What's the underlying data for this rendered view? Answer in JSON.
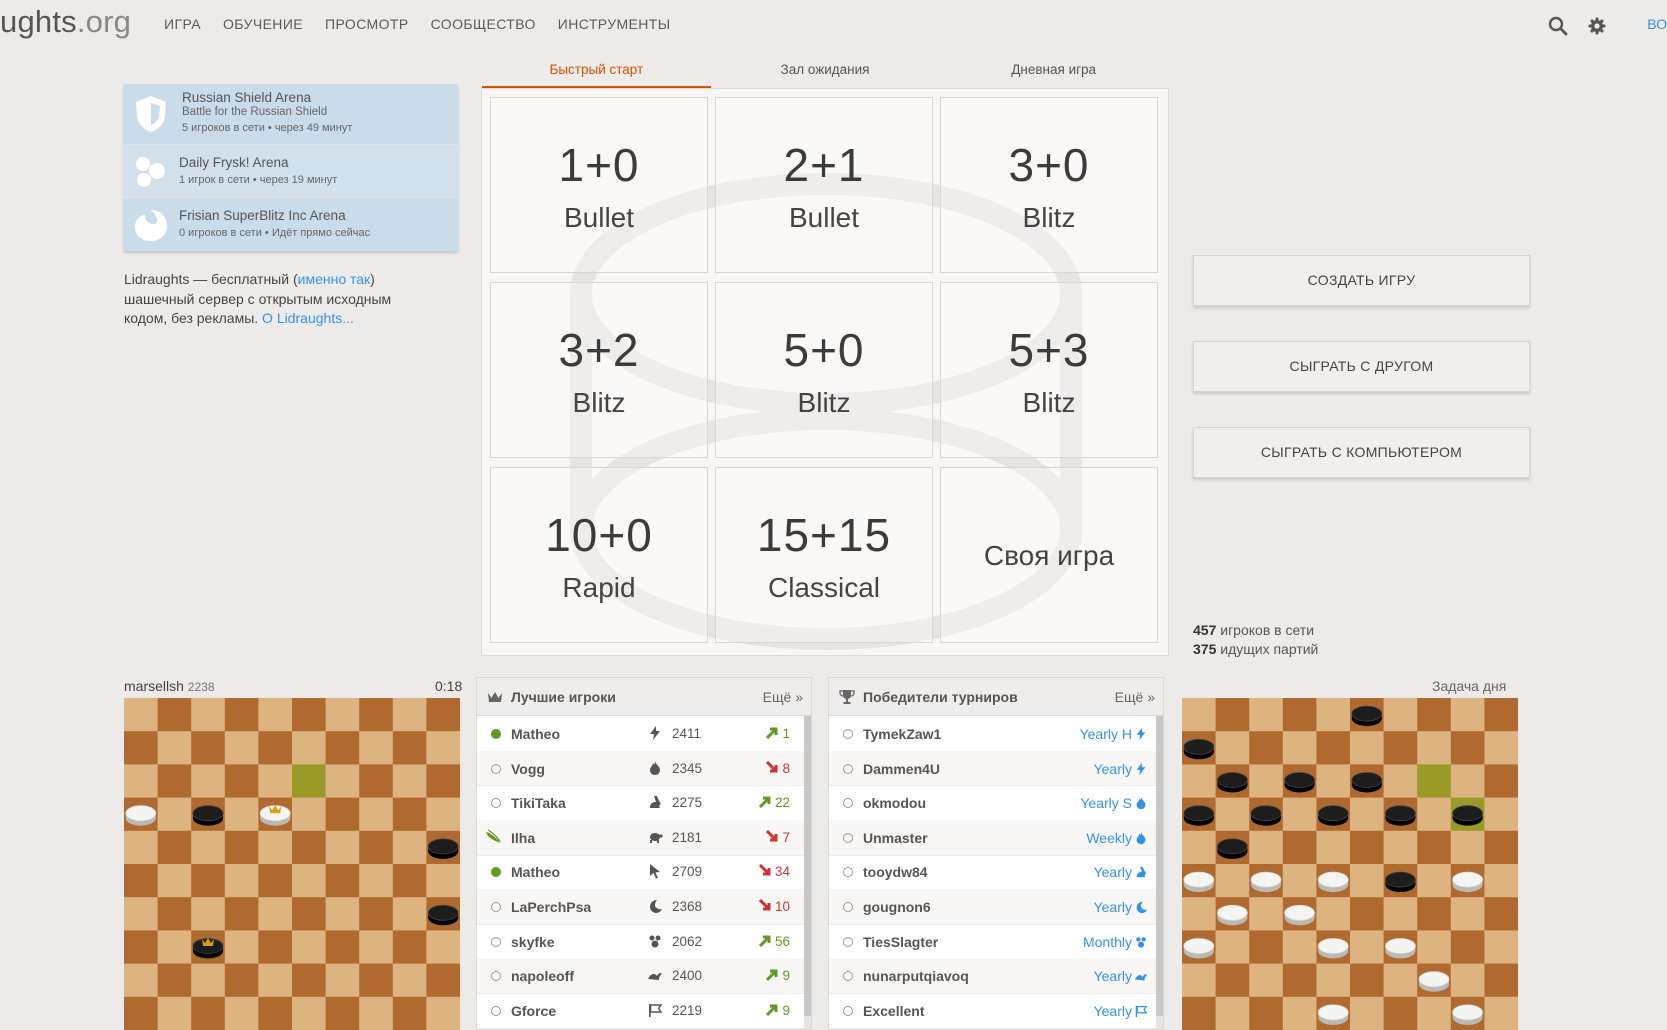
{
  "header": {
    "logo_main": "ughts",
    "logo_tld": ".org",
    "nav": [
      "ИГРА",
      "ОБУЧЕНИЕ",
      "ПРОСМОТР",
      "СООБЩЕСТВО",
      "ИНСТРУМЕНТЫ"
    ],
    "signin": "ВО",
    "icons": [
      "search-icon",
      "gear-icon"
    ]
  },
  "tournaments": [
    {
      "name": "Russian Shield Arena",
      "sub": "Battle for the Russian Shield",
      "meta": "5 игроков в сети •  через 49 минут",
      "icon": "shield-icon"
    },
    {
      "name": "Daily Frysk! Arena",
      "sub": "",
      "meta": "1 игрок в сети •  через 19 минут",
      "icon": "frysk-icon"
    },
    {
      "name": "Frisian SuperBlitz Inc Arena",
      "sub": "",
      "meta": "0 игроков в сети • Идёт прямо сейчас",
      "icon": "frisian-icon"
    }
  ],
  "about": {
    "t1": "Lidraughts — бесплатный (",
    "link1": "именно так",
    "t2": ") шашечный сервер с открытым исходным кодом, без рекламы. ",
    "link2": "О Lidraughts..."
  },
  "tabs": [
    {
      "label": "Быстрый старт",
      "active": true
    },
    {
      "label": "Зал ожидания",
      "active": false
    },
    {
      "label": "Дневная игра",
      "active": false
    }
  ],
  "pool": [
    {
      "clock": "1+0",
      "perf": "Bullet"
    },
    {
      "clock": "2+1",
      "perf": "Bullet"
    },
    {
      "clock": "3+0",
      "perf": "Blitz"
    },
    {
      "clock": "3+2",
      "perf": "Blitz"
    },
    {
      "clock": "5+0",
      "perf": "Blitz"
    },
    {
      "clock": "5+3",
      "perf": "Blitz"
    },
    {
      "clock": "10+0",
      "perf": "Rapid"
    },
    {
      "clock": "15+15",
      "perf": "Classical"
    },
    {
      "custom": "Своя игра"
    }
  ],
  "buttons": {
    "create": "СОЗДАТЬ ИГРУ",
    "friend": "СЫГРАТЬ С ДРУГОМ",
    "computer": "СЫГРАТЬ С КОМПЬЮТЕРОМ"
  },
  "counters": {
    "players_num": "457",
    "players_label": " игроков в сети",
    "games_num": "375",
    "games_label": " идущих партий"
  },
  "tv": {
    "player": "marsellsh",
    "rating": "2238",
    "clock": "0:18"
  },
  "puzzle": {
    "title": "Задача дня"
  },
  "leaders": {
    "title": "Лучшие игроки",
    "more": "Ещё »",
    "rows": [
      {
        "name": "Matheo",
        "online": true,
        "icon": "bolt-icon",
        "rating": "2411",
        "dir": "up",
        "progress": "1"
      },
      {
        "name": "Vogg",
        "online": false,
        "icon": "flame-icon",
        "rating": "2345",
        "dir": "down",
        "progress": "8"
      },
      {
        "name": "TikiTaka",
        "online": false,
        "icon": "rabbit-icon",
        "rating": "2275",
        "dir": "up",
        "progress": "22"
      },
      {
        "name": "Ilha",
        "online": false,
        "patron": true,
        "icon": "turtle-icon",
        "rating": "2181",
        "dir": "down",
        "progress": "7"
      },
      {
        "name": "Matheo",
        "online": true,
        "icon": "cursor-icon",
        "rating": "2709",
        "dir": "down",
        "progress": "34"
      },
      {
        "name": "LaPerchPsa",
        "online": false,
        "icon": "moon-icon",
        "rating": "2368",
        "dir": "down",
        "progress": "10"
      },
      {
        "name": "skyfke",
        "online": false,
        "icon": "paw-icon",
        "rating": "2062",
        "dir": "up",
        "progress": "56"
      },
      {
        "name": "napoleoff",
        "online": false,
        "icon": "wave-icon",
        "rating": "2400",
        "dir": "up",
        "progress": "9"
      },
      {
        "name": "Gforce",
        "online": false,
        "icon": "flag-icon",
        "rating": "2219",
        "dir": "up",
        "progress": "9"
      }
    ]
  },
  "winners": {
    "title": "Победители турниров",
    "more": "Ещё »",
    "rows": [
      {
        "name": "TymekZaw1",
        "tour": "Yearly H",
        "icon": "bolt-icon"
      },
      {
        "name": "Dammen4U",
        "tour": "Yearly",
        "icon": "bolt-icon"
      },
      {
        "name": "okmodou",
        "tour": "Yearly S",
        "icon": "flame-icon"
      },
      {
        "name": "Unmaster",
        "tour": "Weekly",
        "icon": "flame-icon"
      },
      {
        "name": "tooydw84",
        "tour": "Yearly",
        "icon": "rabbit-icon"
      },
      {
        "name": "gougnon6",
        "tour": "Yearly",
        "icon": "moon-icon"
      },
      {
        "name": "TiesSlagter",
        "tour": "Monthly",
        "icon": "paw-icon"
      },
      {
        "name": "nunarputqiavoq",
        "tour": "Yearly",
        "icon": "wave-icon"
      },
      {
        "name": "Excellent",
        "tour": "Yearly",
        "icon": "flag-icon"
      }
    ]
  },
  "colors": {
    "accent": "#d85000",
    "link": "#3692e7",
    "up": "#629924",
    "down": "#cc3333",
    "board_light": "#ddb480",
    "board_dark": "#b06a30"
  }
}
